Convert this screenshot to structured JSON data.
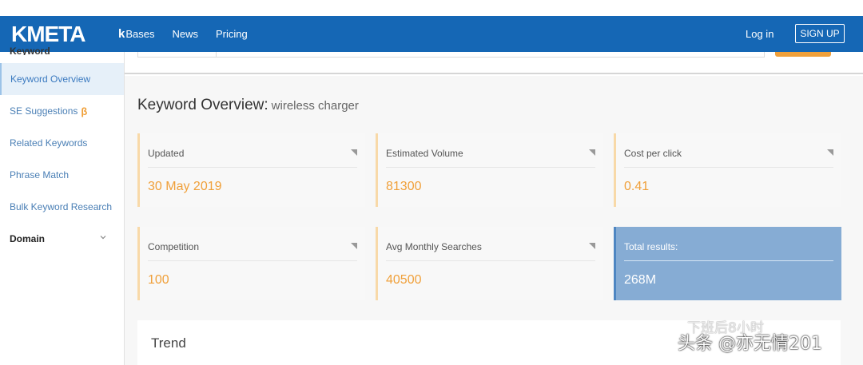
{
  "header": {
    "logo": "KMETA",
    "nav": [
      {
        "label": "Bases",
        "prefix": "k"
      },
      {
        "label": "News"
      },
      {
        "label": "Pricing"
      }
    ],
    "login": "Log in",
    "signup": "SIGN UP"
  },
  "sidebar": {
    "heading": "Keyword",
    "items": [
      {
        "label": "Keyword Overview"
      },
      {
        "label": "SE Suggestions",
        "badge": "β"
      },
      {
        "label": "Related Keywords"
      },
      {
        "label": "Phrase Match"
      },
      {
        "label": "Bulk Keyword Research"
      },
      {
        "label": "Domain"
      }
    ]
  },
  "main": {
    "title": "Keyword Overview:",
    "keyword": "wireless charger",
    "cards": [
      {
        "label": "Updated",
        "value": "30 May 2019"
      },
      {
        "label": "Estimated Volume",
        "value": "81300"
      },
      {
        "label": "Cost per click",
        "value": "0.41"
      },
      {
        "label": "Competition",
        "value": "100"
      },
      {
        "label": "Avg Monthly Searches",
        "value": "40500"
      },
      {
        "label": "Total results:",
        "value": "268M"
      }
    ],
    "trend_title": "Trend"
  },
  "watermark": {
    "line1": "下班后8小时",
    "line2": "头条 @亦无情201"
  },
  "colors": {
    "navbar": "#1567b5",
    "accent": "#f0a03a",
    "highlight_card": "#86acd4"
  }
}
